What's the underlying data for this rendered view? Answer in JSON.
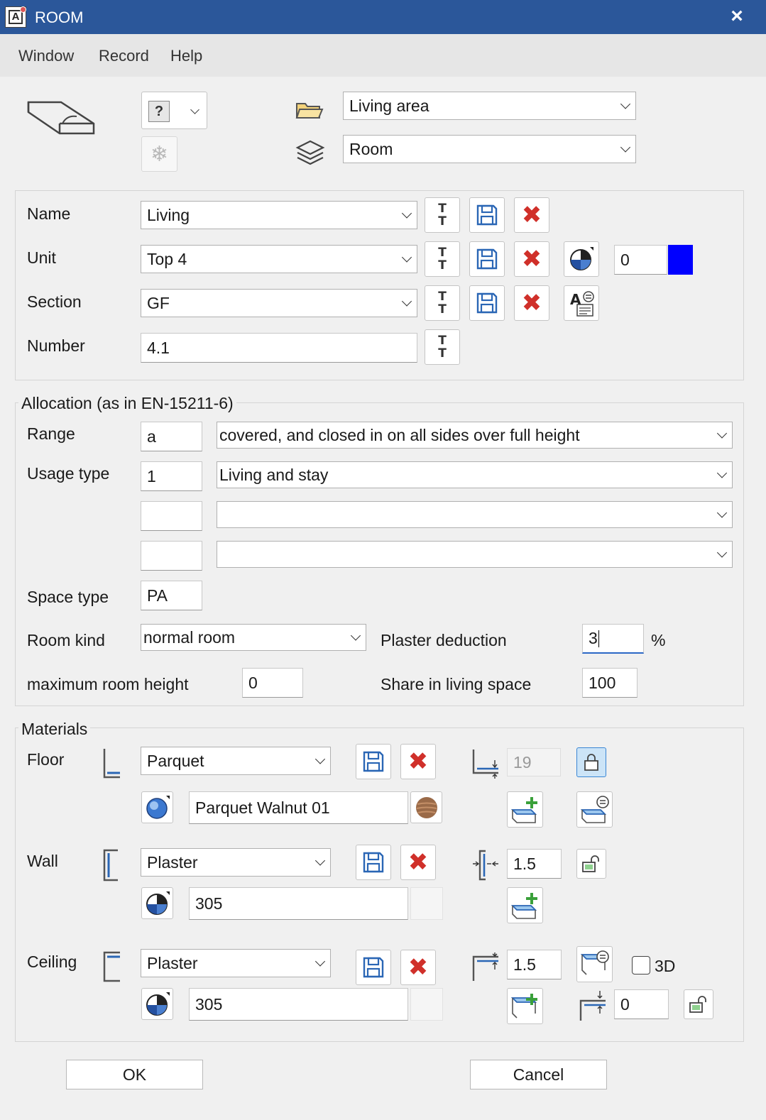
{
  "window": {
    "title": "ROOM",
    "close_icon": "×"
  },
  "menu": [
    "Window",
    "Record",
    "Help"
  ],
  "header": {
    "folder_select": "Living area",
    "layer_select": "Room"
  },
  "ident": {
    "name_label": "Name",
    "name_value": "Living",
    "unit_label": "Unit",
    "unit_value": "Top 4",
    "unit_number": "0",
    "unit_color": "#0000ff",
    "section_label": "Section",
    "section_value": "GF",
    "number_label": "Number",
    "number_value": "4.1"
  },
  "allocation": {
    "title": "Allocation (as in EN-15211-6)",
    "range_label": "Range",
    "range_code": "a",
    "range_desc": "covered, and closed in on all sides over full height",
    "usage_label": "Usage type",
    "usage_code": "1",
    "usage_desc": "Living and stay",
    "usage_code2": "",
    "usage_desc2": "",
    "usage_code3": "",
    "usage_desc3": "",
    "space_label": "Space type",
    "space_value": "PA",
    "roomkind_label": "Room kind",
    "roomkind_value": "normal room",
    "plaster_label": "Plaster deduction",
    "plaster_value": "3",
    "plaster_unit": "%",
    "maxheight_label": "maximum room height",
    "maxheight_value": "0",
    "share_label": "Share in living space",
    "share_value": "100"
  },
  "materials": {
    "title": "Materials",
    "floor_label": "Floor",
    "floor_material": "Parquet",
    "floor_surface": "Parquet Walnut 01",
    "floor_thickness": "19",
    "wall_label": "Wall",
    "wall_material": "Plaster",
    "wall_surface": "305",
    "wall_thickness": "1.5",
    "ceiling_label": "Ceiling",
    "ceiling_material": "Plaster",
    "ceiling_surface": "305",
    "ceiling_thickness": "1.5",
    "ceiling_offset": "0",
    "checkbox_3d_label": "3D",
    "checkbox_3d_checked": false
  },
  "buttons": {
    "ok": "OK",
    "cancel": "Cancel"
  },
  "tt_glyph": "T\nT",
  "help_glyph": "?"
}
